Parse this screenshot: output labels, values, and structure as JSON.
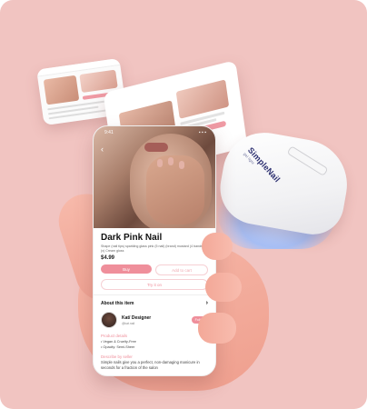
{
  "status_bar": {
    "time": "9:41",
    "signal": "▪ ▪ ▪"
  },
  "product": {
    "title": "Dark Pink Nail",
    "description": "Shape (nail tips) sparkling glass pink (5 nail) (brand) mustard  (4 bands) (x) Cream gloss",
    "price": "$4.99",
    "buy_label": "Buy",
    "cart_label": "Add to cart",
    "try_label": "Try it on"
  },
  "about": {
    "heading": "About this item",
    "designer_name": "Kat/ Designer",
    "designer_handle": "@kat.nail",
    "follow_label": "Follow",
    "details_heading": "Product details",
    "details": [
      "Vegan & Cruelty-Free",
      "Opacity: Semi-Sheer"
    ],
    "seller_heading": "Describe by seller",
    "seller_text": "Simple nails give you a perfect, non-damaging manicure in seconds for a fraction of the salon"
  },
  "lamp": {
    "brand": "SimpleNail",
    "tagline": "gel light"
  },
  "colors": {
    "background": "#f1c4c1",
    "accent": "#ef8f9b"
  }
}
